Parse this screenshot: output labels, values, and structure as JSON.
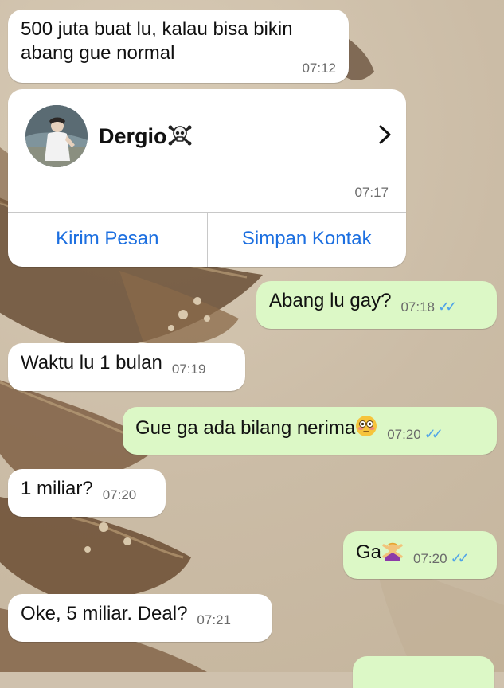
{
  "colors": {
    "incoming_bubble": "#ffffff",
    "outgoing_bubble": "#dcf8c6",
    "read_ticks": "#4fa3e8",
    "link_blue": "#1c6fe0",
    "timestamp": "#6b6b6b"
  },
  "messages": [
    {
      "text": "500 juta buat lu, kalau bisa bikin abang gue normal",
      "time": "07:12",
      "direction": "incoming"
    },
    {
      "text": "Abang lu gay?",
      "time": "07:18",
      "direction": "outgoing",
      "ticks": "✓✓"
    },
    {
      "text": "Waktu lu 1 bulan",
      "time": "07:19",
      "direction": "incoming"
    },
    {
      "text": "Gue ga ada bilang nerima",
      "emoji": "flushed-face-icon",
      "time": "07:20",
      "direction": "outgoing",
      "ticks": "✓✓"
    },
    {
      "text": "1 miliar?",
      "time": "07:20",
      "direction": "incoming"
    },
    {
      "text": "Ga",
      "emoji": "person-gesturing-no-icon",
      "time": "07:20",
      "direction": "outgoing",
      "ticks": "✓✓"
    },
    {
      "text": "Oke, 5 miliar. Deal?",
      "time": "07:21",
      "direction": "incoming"
    }
  ],
  "contact_card": {
    "name": "Dergio",
    "name_emoji": "skull-crossbones-icon",
    "time": "07:17",
    "send_message_label": "Kirim Pesan",
    "save_contact_label": "Simpan Kontak"
  }
}
